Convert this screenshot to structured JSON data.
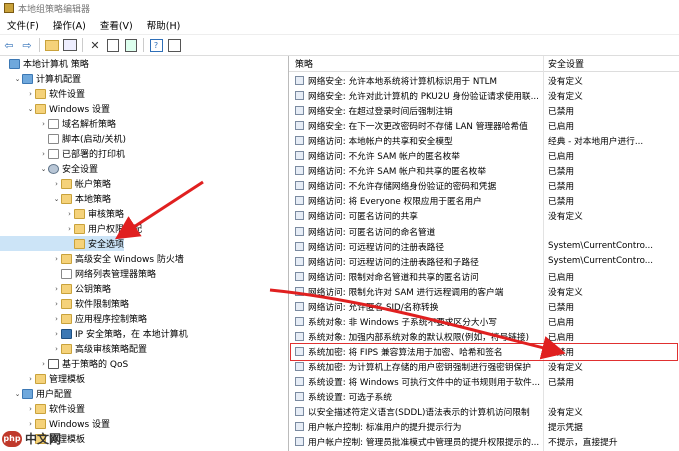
{
  "window": {
    "title": "本地组策略编辑器"
  },
  "menu": [
    "文件(F)",
    "操作(A)",
    "查看(V)",
    "帮助(H)"
  ],
  "toolbar": [
    "back-arrow-icon",
    "forward-arrow-icon",
    "folder-up-icon",
    "show-hide-tree-icon",
    "delete-icon",
    "properties-icon",
    "export-icon",
    "help-icon",
    "view-icon"
  ],
  "tree": [
    {
      "label": "本地计算机 策略",
      "depth": 0,
      "exp": "",
      "icon": "pc"
    },
    {
      "label": "计算机配置",
      "depth": 1,
      "exp": "v",
      "icon": "pc"
    },
    {
      "label": "软件设置",
      "depth": 2,
      "exp": ">",
      "icon": "folder"
    },
    {
      "label": "Windows 设置",
      "depth": 2,
      "exp": "v",
      "icon": "folder"
    },
    {
      "label": "域名解析策略",
      "depth": 3,
      "exp": ">",
      "icon": "doc"
    },
    {
      "label": "脚本(启动/关机)",
      "depth": 3,
      "exp": "",
      "icon": "doc"
    },
    {
      "label": "已部署的打印机",
      "depth": 3,
      "exp": ">",
      "icon": "doc"
    },
    {
      "label": "安全设置",
      "depth": 3,
      "exp": "v",
      "icon": "gear"
    },
    {
      "label": "帐户策略",
      "depth": 4,
      "exp": ">",
      "icon": "folder"
    },
    {
      "label": "本地策略",
      "depth": 4,
      "exp": "v",
      "icon": "folder"
    },
    {
      "label": "审核策略",
      "depth": 5,
      "exp": ">",
      "icon": "folder"
    },
    {
      "label": "用户权限分配",
      "depth": 5,
      "exp": ">",
      "icon": "folder"
    },
    {
      "label": "安全选项",
      "depth": 5,
      "exp": "",
      "icon": "folder",
      "selected": true
    },
    {
      "label": "高级安全 Windows 防火墙",
      "depth": 4,
      "exp": ">",
      "icon": "folder"
    },
    {
      "label": "网络列表管理器策略",
      "depth": 4,
      "exp": "",
      "icon": "doc"
    },
    {
      "label": "公钥策略",
      "depth": 4,
      "exp": ">",
      "icon": "folder"
    },
    {
      "label": "软件限制策略",
      "depth": 4,
      "exp": ">",
      "icon": "folder"
    },
    {
      "label": "应用程序控制策略",
      "depth": 4,
      "exp": ">",
      "icon": "folder"
    },
    {
      "label": "IP 安全策略，在 本地计算机",
      "depth": 4,
      "exp": ">",
      "icon": "shield"
    },
    {
      "label": "高级审核策略配置",
      "depth": 4,
      "exp": ">",
      "icon": "folder"
    },
    {
      "label": "基于策略的 QoS",
      "depth": 3,
      "exp": ">",
      "icon": "chart"
    },
    {
      "label": "管理模板",
      "depth": 2,
      "exp": ">",
      "icon": "folder"
    },
    {
      "label": "用户配置",
      "depth": 1,
      "exp": "v",
      "icon": "pc"
    },
    {
      "label": "软件设置",
      "depth": 2,
      "exp": ">",
      "icon": "folder"
    },
    {
      "label": "Windows 设置",
      "depth": 2,
      "exp": ">",
      "icon": "folder"
    },
    {
      "label": "管理模板",
      "depth": 2,
      "exp": ">",
      "icon": "folder"
    }
  ],
  "columns": {
    "policy": "策略",
    "setting": "安全设置"
  },
  "policies": [
    {
      "name": "网络安全: 允许本地系统将计算机标识用于 NTLM",
      "value": "没有定义"
    },
    {
      "name": "网络安全: 允许对此计算机的 PKU2U 身份验证请求使用联...",
      "value": "没有定义"
    },
    {
      "name": "网络安全: 在超过登录时间后强制注销",
      "value": "已禁用"
    },
    {
      "name": "网络安全: 在下一次更改密码时不存储 LAN 管理器哈希值",
      "value": "已启用"
    },
    {
      "name": "网络访问: 本地帐户的共享和安全模型",
      "value": "经典 - 对本地用户进行..."
    },
    {
      "name": "网络访问: 不允许 SAM 帐户的匿名枚举",
      "value": "已启用"
    },
    {
      "name": "网络访问: 不允许 SAM 帐户和共享的匿名枚举",
      "value": "已禁用"
    },
    {
      "name": "网络访问: 不允许存储网络身份验证的密码和凭据",
      "value": "已禁用"
    },
    {
      "name": "网络访问: 将 Everyone 权限应用于匿名用户",
      "value": "已禁用"
    },
    {
      "name": "网络访问: 可匿名访问的共享",
      "value": "没有定义"
    },
    {
      "name": "网络访问: 可匿名访问的命名管道",
      "value": ""
    },
    {
      "name": "网络访问: 可远程访问的注册表路径",
      "value": "System\\CurrentContro..."
    },
    {
      "name": "网络访问: 可远程访问的注册表路径和子路径",
      "value": "System\\CurrentContro..."
    },
    {
      "name": "网络访问: 限制对命名管道和共享的匿名访问",
      "value": "已启用"
    },
    {
      "name": "网络访问: 限制允许对 SAM 进行远程调用的客户端",
      "value": "没有定义"
    },
    {
      "name": "网络访问: 允许匿名 SID/名称转换",
      "value": "已禁用"
    },
    {
      "name": "系统对象: 非 Windows 子系统不要求区分大小写",
      "value": "已启用"
    },
    {
      "name": "系统对象: 加强内部系统对象的默认权限(例如，符号链接)",
      "value": "已启用"
    },
    {
      "name": "系统加密: 将 FIPS 兼容算法用于加密、哈希和签名",
      "value": "已禁用",
      "highlight": true
    },
    {
      "name": "系统加密: 为计算机上存储的用户密钥强制进行强密钥保护",
      "value": "没有定义"
    },
    {
      "name": "系统设置: 将 Windows 可执行文件中的证书规则用于软件...",
      "value": "已禁用"
    },
    {
      "name": "系统设置: 可选子系统",
      "value": ""
    },
    {
      "name": "以安全描述符定义语言(SDDL)语法表示的计算机访问限制",
      "value": "没有定义"
    },
    {
      "name": "用户帐户控制: 标准用户的提升提示行为",
      "value": "提示凭据"
    },
    {
      "name": "用户帐户控制: 管理员批准模式中管理员的提升权限提示的...",
      "value": "不提示，直接提升"
    }
  ],
  "watermark": {
    "badge": "php",
    "text": "中文网"
  }
}
